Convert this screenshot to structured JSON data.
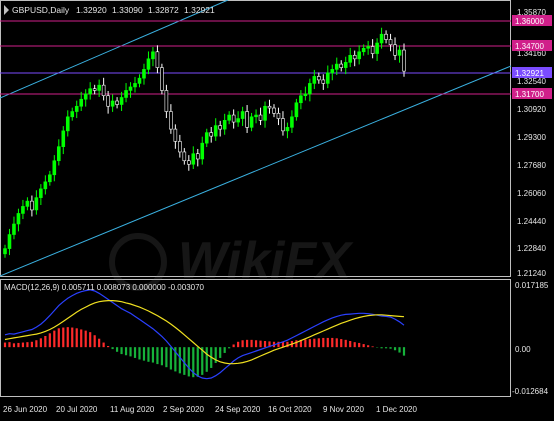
{
  "window": {
    "title": "GBPUSD,Daily",
    "ohlc": [
      "1.32920",
      "1.33090",
      "1.32872",
      "1.32921"
    ]
  },
  "colors": {
    "background": "#000000",
    "bull_candle": "#00ff00",
    "bear_candle": "#ffffff",
    "channel": "#3ab0e0",
    "resistance": "#d0208a",
    "current_price": "#7b4cff",
    "axis": "#bfbfbf",
    "macd_pos": "#ff2a2a",
    "macd_neg": "#16b23a",
    "signal": "#f0e020",
    "macd_line": "#2a40ff"
  },
  "price_axis": {
    "ticks": [
      "1.35870",
      "1.34160",
      "1.32540",
      "1.30920",
      "1.29300",
      "1.27680",
      "1.26060",
      "1.24440",
      "1.22840",
      "1.21240"
    ],
    "levels": [
      "1.36000",
      "1.34700",
      "1.33540",
      "1.31700"
    ],
    "current_price": "1.32921"
  },
  "macd": {
    "label": "MACD(12,26,9) 0.005711 0.008073 0.000000 -0.003070",
    "ticks": [
      "0.017185",
      "0.00",
      "-0.012684"
    ]
  },
  "time_axis": [
    "26 Jun 2020",
    "20 Jul 2020",
    "11 Aug 2020",
    "2 Sep 2020",
    "24 Sep 2020",
    "16 Oct 2020",
    "9 Nov 2020",
    "1 Dec 2020"
  ],
  "watermark": "WikiFX",
  "chart_data": [
    {
      "type": "candlestick",
      "title": "GBPUSD,Daily",
      "ylim": [
        1.2124,
        1.3672
      ],
      "x_dates": [
        "26 Jun 2020",
        "20 Jul 2020",
        "11 Aug 2020",
        "2 Sep 2020",
        "24 Sep 2020",
        "16 Oct 2020",
        "9 Nov 2020",
        "1 Dec 2020"
      ],
      "series": [
        {
          "name": "close",
          "values": [
            1.228,
            1.236,
            1.242,
            1.248,
            1.252,
            1.255,
            1.25,
            1.257,
            1.262,
            1.266,
            1.27,
            1.278,
            1.286,
            1.295,
            1.303,
            1.306,
            1.309,
            1.313,
            1.316,
            1.319,
            1.318,
            1.321,
            1.315,
            1.309,
            1.312,
            1.31,
            1.314,
            1.318,
            1.32,
            1.322,
            1.325,
            1.33,
            1.336,
            1.34,
            1.331,
            1.318,
            1.306,
            1.296,
            1.289,
            1.283,
            1.278,
            1.276,
            1.282,
            1.279,
            1.288,
            1.294,
            1.292,
            1.298,
            1.296,
            1.301,
            1.304,
            1.3,
            1.302,
            1.306,
            1.297,
            1.303,
            1.304,
            1.301,
            1.309,
            1.308,
            1.305,
            1.302,
            1.295,
            1.297,
            1.303,
            1.311,
            1.315,
            1.316,
            1.322,
            1.326,
            1.324,
            1.322,
            1.328,
            1.33,
            1.333,
            1.331,
            1.334,
            1.338,
            1.336,
            1.34,
            1.342,
            1.343,
            1.339,
            1.345,
            1.35,
            1.347,
            1.344,
            1.338,
            1.341,
            1.329
          ]
        }
      ],
      "annotations": [
        "1.36000",
        "1.34700",
        "1.33540",
        "1.31700",
        "1.32921"
      ]
    },
    {
      "type": "bar",
      "title": "MACD(12,26,9) 0.005711 0.008073 0.000000 -0.003070",
      "ylim": [
        -0.012684,
        0.017185
      ],
      "series": [
        {
          "name": "main",
          "values": [
            0.0032,
            0.0035,
            0.0034,
            0.0037,
            0.004,
            0.0043,
            0.0046,
            0.0052,
            0.006,
            0.007,
            0.0082,
            0.0095,
            0.0108,
            0.0118,
            0.0127,
            0.0134,
            0.014,
            0.0144,
            0.0147,
            0.0149,
            0.0146,
            0.014,
            0.0132,
            0.0124,
            0.0116,
            0.0108,
            0.01,
            0.0094,
            0.0088,
            0.008,
            0.0072,
            0.0064,
            0.0056,
            0.0048,
            0.0038,
            0.0028,
            0.0016,
            0.0002,
            -0.0012,
            -0.0026,
            -0.004,
            -0.0054,
            -0.0066,
            -0.0075,
            -0.008,
            -0.0082,
            -0.008,
            -0.0074,
            -0.0066,
            -0.0056,
            -0.0046,
            -0.0036,
            -0.0028,
            -0.0022,
            -0.0018,
            -0.0014,
            -0.001,
            -0.0006,
            -0.0002,
            0.0002,
            0.0006,
            0.001,
            0.0014,
            0.0018,
            0.0024,
            0.003,
            0.0036,
            0.0042,
            0.0048,
            0.0054,
            0.006,
            0.0066,
            0.0071,
            0.0076,
            0.008,
            0.0083,
            0.0085,
            0.0086,
            0.0087,
            0.0088,
            0.0088,
            0.0087,
            0.0085,
            0.0083,
            0.0081,
            0.008,
            0.0078,
            0.0073,
            0.0066,
            0.0057
          ]
        },
        {
          "name": "signal",
          "values": [
            0.002,
            0.0022,
            0.0024,
            0.0026,
            0.0028,
            0.003,
            0.0032,
            0.0034,
            0.0037,
            0.0041,
            0.0046,
            0.0052,
            0.0059,
            0.0067,
            0.0075,
            0.0083,
            0.0091,
            0.0098,
            0.0104,
            0.011,
            0.0115,
            0.0118,
            0.012,
            0.0121,
            0.0121,
            0.012,
            0.0118,
            0.0115,
            0.0112,
            0.0108,
            0.0104,
            0.0099,
            0.0094,
            0.0088,
            0.0082,
            0.0075,
            0.0068,
            0.006,
            0.0051,
            0.0042,
            0.0032,
            0.0022,
            0.0012,
            0.0002,
            -0.0008,
            -0.0018,
            -0.0026,
            -0.0033,
            -0.0038,
            -0.0041,
            -0.0043,
            -0.0043,
            -0.0042,
            -0.004,
            -0.0037,
            -0.0033,
            -0.0028,
            -0.0023,
            -0.0018,
            -0.0013,
            -0.0008,
            -0.0004,
            0.0,
            0.0004,
            0.0008,
            0.0012,
            0.0017,
            0.0022,
            0.0027,
            0.0032,
            0.0037,
            0.0042,
            0.0047,
            0.0052,
            0.0057,
            0.0062,
            0.0066,
            0.007,
            0.0074,
            0.0077,
            0.008,
            0.0082,
            0.0083,
            0.0084,
            0.0084,
            0.0083,
            0.0082,
            0.0081,
            0.008,
            0.0079
          ]
        }
      ]
    }
  ]
}
